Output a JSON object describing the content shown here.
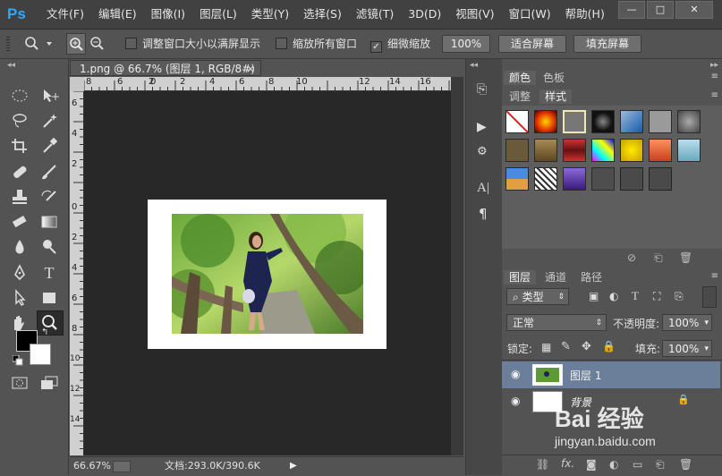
{
  "app": {
    "logo": "Ps"
  },
  "menu": [
    "文件(F)",
    "编辑(E)",
    "图像(I)",
    "图层(L)",
    "类型(Y)",
    "选择(S)",
    "滤镜(T)",
    "3D(D)",
    "视图(V)",
    "窗口(W)",
    "帮助(H)"
  ],
  "window_controls": {
    "minimize": "—",
    "maximize": "□",
    "close": "✕"
  },
  "options": {
    "resize_windows": "调整窗口大小以满屏显示",
    "zoom_all": "缩放所有窗口",
    "scrubby_zoom": "细微缩放",
    "pct_button": "100%",
    "fit_screen": "适合屏幕",
    "fill_screen": "填充屏幕"
  },
  "document": {
    "tab_title": "1.png @ 66.7% (图层 1, RGB/8#) *",
    "tab_close": "×",
    "zoom": "66.67%",
    "doc_info": "文档:293.0K/390.6K",
    "ruler_h": [
      "8",
      "6",
      "4",
      "2",
      "0",
      "2",
      "4",
      "6",
      "8",
      "10",
      "12",
      "14",
      "16"
    ],
    "ruler_v": [
      "6",
      "4",
      "2",
      "0",
      "2",
      "4",
      "6",
      "8",
      "10",
      "12",
      "14"
    ]
  },
  "panels": {
    "color_tab": "颜色",
    "swatches_tab": "色板",
    "adjust_tab": "调整",
    "styles_tab": "样式",
    "layers_tab": "图层",
    "channels_tab": "通道",
    "paths_tab": "路径"
  },
  "layers": {
    "filter_kind": "类型",
    "blend_mode": "正常",
    "opacity_label": "不透明度:",
    "opacity_value": "100%",
    "lock_label": "锁定:",
    "fill_label": "填充:",
    "fill_value": "100%",
    "items": [
      {
        "name": "图层 1",
        "selected": true
      },
      {
        "name": "背景",
        "locked": true
      }
    ]
  },
  "watermark": {
    "brand": "Bai 经验",
    "url": "jingyan.baidu.com"
  },
  "colors": {
    "accent": "#31a8ff",
    "selected_layer": "#6b7e9a"
  }
}
